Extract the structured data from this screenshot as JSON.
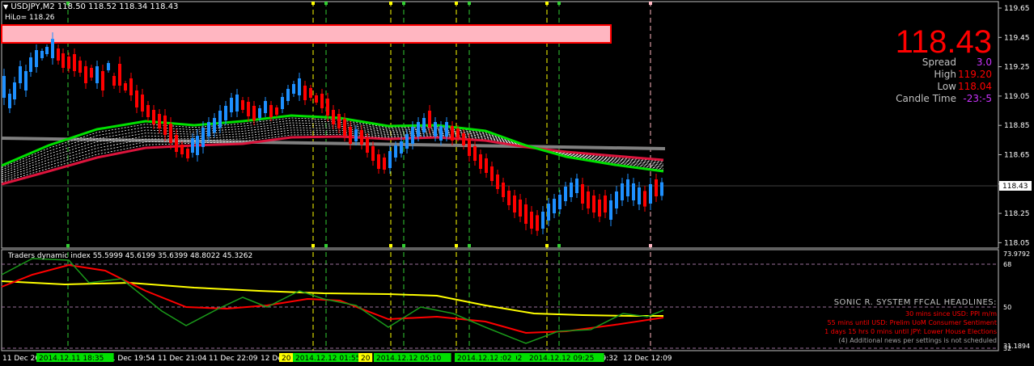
{
  "header": {
    "symbol_line": "USDJPY,M2  118.50 118.52 118.34 118.43",
    "hilo_line": "HiLo= 118.26"
  },
  "info_panel": {
    "big_price": "118.43",
    "rows": [
      {
        "label": "Spread",
        "value": "3.0"
      },
      {
        "label": "High",
        "value": "119.20"
      },
      {
        "label": "Low",
        "value": "118.04"
      },
      {
        "label": "Candle Time",
        "value": "-23:-5"
      }
    ]
  },
  "price_axis": {
    "ticks": [
      "119.65",
      "119.45",
      "119.25",
      "119.05",
      "118.85",
      "118.65",
      "118.45",
      "118.25",
      "118.05"
    ],
    "current_price_tag": "118.43"
  },
  "indicator": {
    "title": "Traders dynamic index 55.5999 45.6199 35.6399 48.8022 45.3262",
    "axis_ticks": [
      "73.9792",
      "68",
      "50",
      "32",
      "31.1894"
    ]
  },
  "headlines": {
    "title": "SONIC R. SYSTEM  FFCAL HEADLINES:",
    "items": [
      "30 mins since USD: PPI m/m",
      "55 mins until USD: Prelim UoM Consumer Sentiment",
      "1 days 15 hrs 0 mins until JPY: Lower House Elections",
      "(4)  Additional news per settings is not scheduled"
    ]
  },
  "time_axis": {
    "labels": [
      "11 Dec 20",
      "11 Dec 19:54",
      "11 Dec 21:04",
      "11 Dec 22:09",
      "12 De",
      "c 09:32",
      "12 Dec 12:09"
    ],
    "event_tags": [
      {
        "text": "2014.12.11 18:35",
        "color": "green"
      },
      {
        "text": "20",
        "color": "yellow"
      },
      {
        "text": "2014.12.12 01:55",
        "color": "green"
      },
      {
        "text": "20",
        "color": "yellow"
      },
      {
        "text": "2014.12.12 05:10",
        "color": "green"
      },
      {
        "text": "2014.12.12 08:02",
        "color": "green"
      },
      {
        "text": ":02",
        "color": "green"
      },
      {
        "text": "2014.12.12 09:25",
        "color": "green"
      }
    ]
  },
  "colors": {
    "bull": "#1e90ff",
    "bear": "#ff0000",
    "fast_ema": "#00e000",
    "slow_ema": "#dc143c",
    "flat_ma": "#808080",
    "tdi_green": "#1a9a1a",
    "tdi_red": "#ff0000",
    "tdi_yellow": "#ffff00",
    "grid_line": "#8b6f8b"
  }
}
